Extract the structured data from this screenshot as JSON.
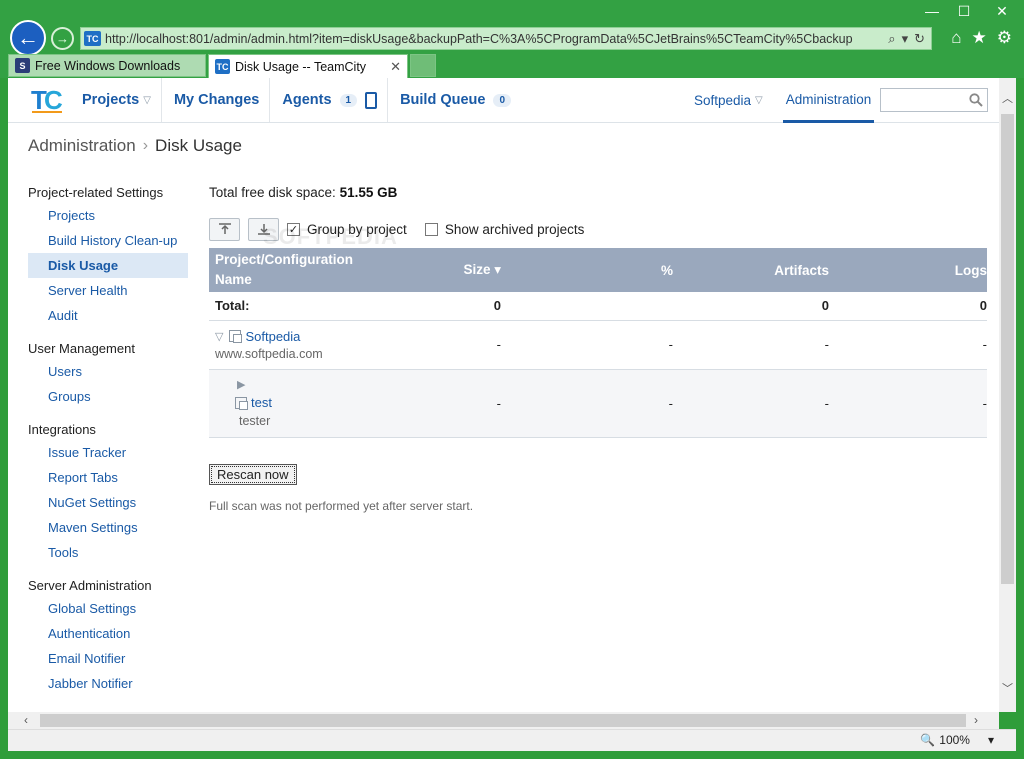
{
  "browser": {
    "url": "http://localhost:801/admin/admin.html?item=diskUsage&backupPath=C%3A%5CProgramData%5CJetBrains%5CTeamCity%5Cbackup",
    "tabs": [
      {
        "title": "Free Windows Downloads",
        "favicon": "S"
      },
      {
        "title": "Disk Usage -- TeamCity",
        "favicon": "TC"
      }
    ],
    "zoom": "100%"
  },
  "header": {
    "nav": {
      "projects": "Projects",
      "my_changes": "My Changes",
      "agents": "Agents",
      "agents_count": "1",
      "build_queue": "Build Queue",
      "build_queue_count": "0"
    },
    "user": "Softpedia",
    "admin": "Administration",
    "search_placeholder": ""
  },
  "breadcrumb": {
    "root": "Administration",
    "current": "Disk Usage"
  },
  "sidebar": {
    "groups": [
      {
        "title": "Project-related Settings",
        "items": [
          "Projects",
          "Build History Clean-up",
          "Disk Usage",
          "Server Health",
          "Audit"
        ]
      },
      {
        "title": "User Management",
        "items": [
          "Users",
          "Groups"
        ]
      },
      {
        "title": "Integrations",
        "items": [
          "Issue Tracker",
          "Report Tabs",
          "NuGet Settings",
          "Maven Settings",
          "Tools"
        ]
      },
      {
        "title": "Server Administration",
        "items": [
          "Global Settings",
          "Authentication",
          "Email Notifier",
          "Jabber Notifier"
        ]
      }
    ],
    "selected": "Disk Usage"
  },
  "main": {
    "free_disk_label": "Total free disk space:",
    "free_disk_value": "51.55 GB",
    "group_by_project": "Group by project",
    "show_archived": "Show archived projects",
    "watermark": "SOFTPEDIA",
    "table": {
      "headers": {
        "name_line1": "Project/Configuration",
        "name_line2": "Name",
        "size": "Size ▾",
        "percent": "%",
        "artifacts": "Artifacts",
        "logs": "Logs"
      },
      "total": {
        "label": "Total:",
        "size": "0",
        "percent": "",
        "artifacts": "0",
        "logs": "0"
      },
      "project": {
        "name": "Softpedia",
        "desc": "www.softpedia.com",
        "size": "-",
        "percent": "-",
        "artifacts": "-",
        "logs": "-"
      },
      "config": {
        "name": "test",
        "desc": "tester",
        "size": "-",
        "percent": "-",
        "artifacts": "-",
        "logs": "-"
      }
    },
    "rescan_button": "Rescan now",
    "scan_note": "Full scan was not performed yet after server start."
  }
}
